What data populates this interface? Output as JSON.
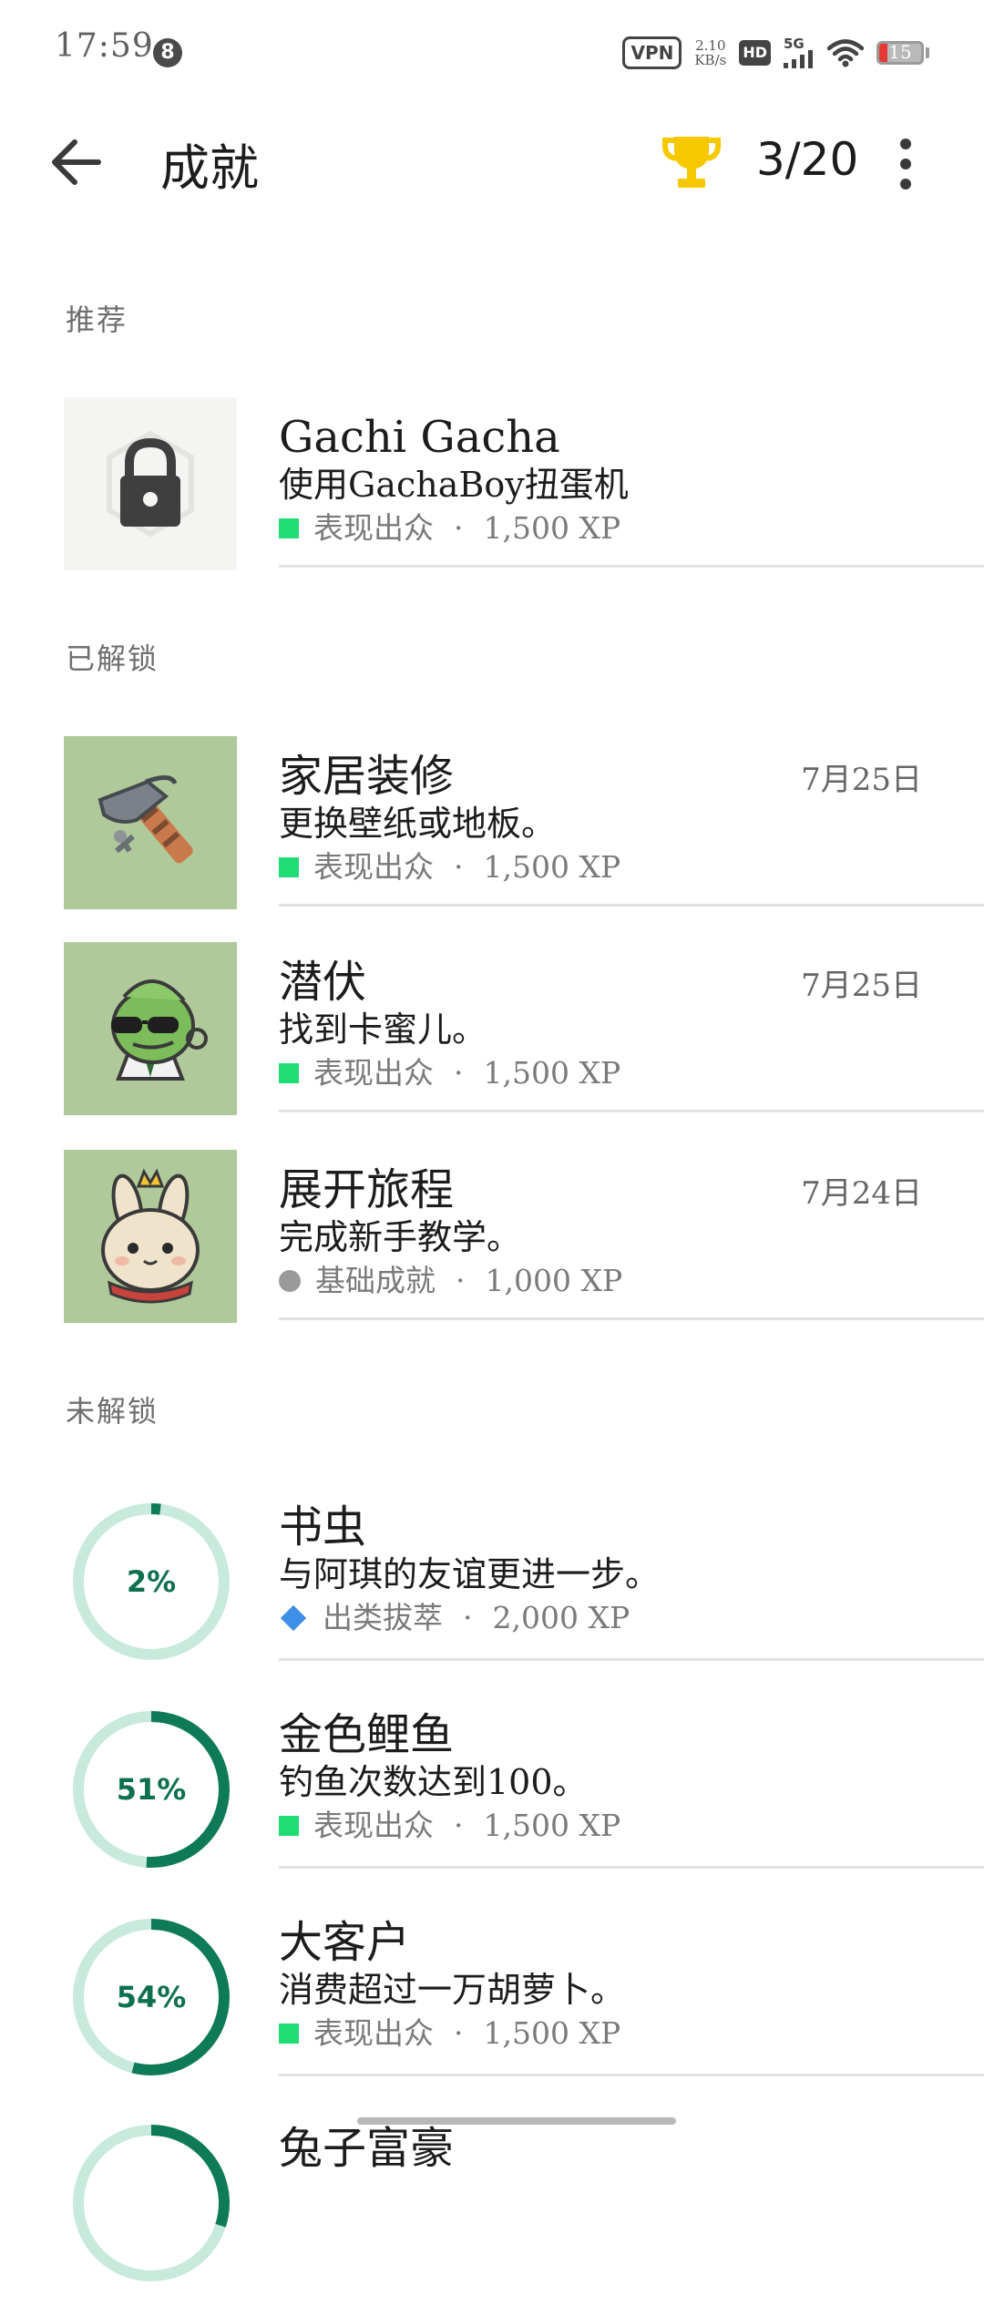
{
  "status_bar": {
    "time": "17:59",
    "notification_count": "8",
    "vpn_label": "VPN",
    "speed_value": "2.10",
    "speed_unit": "KB/s",
    "hd_label": "HD",
    "network_label": "5G",
    "battery_level": "15"
  },
  "header": {
    "title": "成就",
    "counter": "3/20"
  },
  "sections": {
    "recommended": "推荐",
    "unlocked": "已解锁",
    "locked": "未解锁"
  },
  "recommended_items": [
    {
      "title": "Gachi Gacha",
      "description": "使用GachaBoy扭蛋机",
      "tier": "表现出众",
      "xp": "1,500 XP",
      "icon": "lock-icon"
    }
  ],
  "unlocked_items": [
    {
      "title": "家居装修",
      "description": "更换壁纸或地板。",
      "tier": "表现出众",
      "xp": "1,500 XP",
      "date": "7月25日",
      "icon": "hammer-icon"
    },
    {
      "title": "潜伏",
      "description": "找到卡蜜儿。",
      "tier": "表现出众",
      "xp": "1,500 XP",
      "date": "7月25日",
      "icon": "chameleon-icon"
    },
    {
      "title": "展开旅程",
      "description": "完成新手教学。",
      "tier": "基础成就",
      "xp": "1,000 XP",
      "date": "7月24日",
      "icon": "bunny-icon"
    }
  ],
  "locked_items": [
    {
      "title": "书虫",
      "description": "与阿琪的友谊更进一步。",
      "tier": "出类拔萃",
      "xp": "2,000 XP",
      "progress_label": "2%",
      "progress": 0.02
    },
    {
      "title": "金色鲤鱼",
      "description": "钓鱼次数达到100。",
      "tier": "表现出众",
      "xp": "1,500 XP",
      "progress_label": "51%",
      "progress": 0.51
    },
    {
      "title": "大客户",
      "description": "消费超过一万胡萝卜。",
      "tier": "表现出众",
      "xp": "1,500 XP",
      "progress_label": "54%",
      "progress": 0.54
    },
    {
      "title": "兔子富豪",
      "progress": 0.3
    }
  ],
  "colors": {
    "tier_outstanding": "#1fdc75",
    "tier_basic": "#9a9a9a",
    "tier_excellent": "#3d8fe8",
    "progress_track": "#c8eadc",
    "progress_fill": "#0f7a57",
    "thumb_bg": "#b0c99a",
    "trophy": "#f5c800"
  }
}
